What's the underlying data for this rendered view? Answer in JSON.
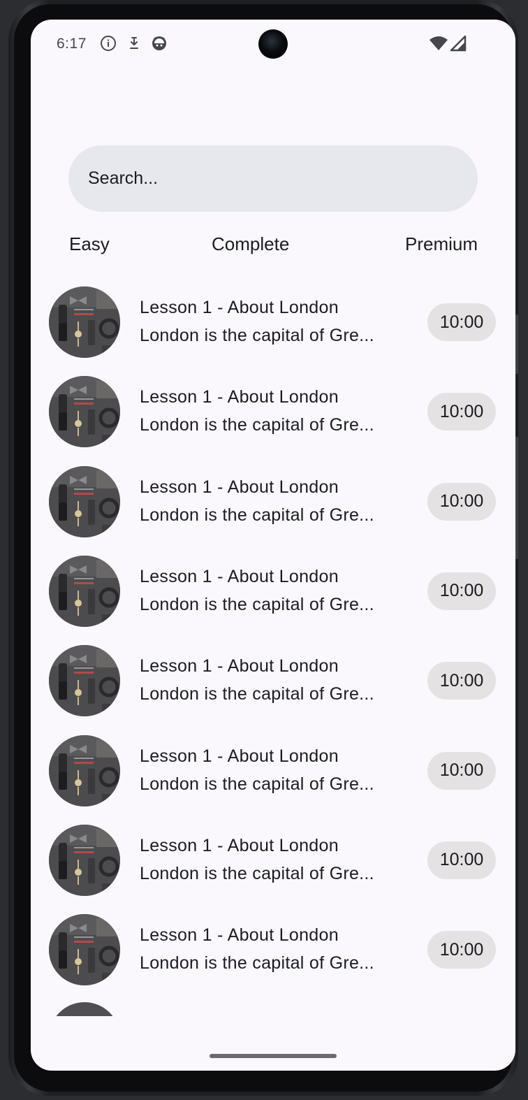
{
  "status_bar": {
    "time": "6:17",
    "icons": [
      "info-icon",
      "download-icon",
      "android-face-icon"
    ],
    "right_icons": [
      "wifi-icon",
      "signal-icon"
    ]
  },
  "search": {
    "placeholder": "Search..."
  },
  "filters": [
    {
      "label": "Easy"
    },
    {
      "label": "Complete"
    },
    {
      "label": "Premium"
    }
  ],
  "lessons": [
    {
      "title": "Lesson 1 - About London",
      "subtitle": "London is the capital of Gre...",
      "duration": "10:00"
    },
    {
      "title": "Lesson 1 - About London",
      "subtitle": "London is the capital of Gre...",
      "duration": "10:00"
    },
    {
      "title": "Lesson 1 - About London",
      "subtitle": "London is the capital of Gre...",
      "duration": "10:00"
    },
    {
      "title": "Lesson 1 - About London",
      "subtitle": "London is the capital of Gre...",
      "duration": "10:00"
    },
    {
      "title": "Lesson 1 - About London",
      "subtitle": "London is the capital of Gre...",
      "duration": "10:00"
    },
    {
      "title": "Lesson 1 - About London",
      "subtitle": "London is the capital of Gre...",
      "duration": "10:00"
    },
    {
      "title": "Lesson 1 - About London",
      "subtitle": "London is the capital of Gre...",
      "duration": "10:00"
    },
    {
      "title": "Lesson 1 - About London",
      "subtitle": "London is the capital of Gre...",
      "duration": "10:00"
    }
  ],
  "colors": {
    "background": "#fbf8fd",
    "search_bg": "#e6e8ee",
    "chip_bg": "#e4e2e2",
    "text": "#1b1c20"
  }
}
